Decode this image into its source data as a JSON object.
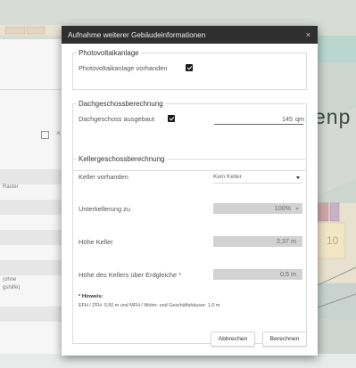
{
  "background": {
    "map_label": "enp",
    "map_number": "10",
    "side_texts": [
      "Raster",
      "(ohne",
      "gshilfe)"
    ]
  },
  "modal": {
    "title": "Aufnahme weiterer Gebäudeinformationen",
    "close_label": "×",
    "photovoltaik": {
      "legend": "Photovoltaikanlage",
      "label": "Photovoltaikanlage vorhanden",
      "checked": true
    },
    "dachgeschoss": {
      "legend": "Dachgeschossberechnung",
      "label": "Dachgeschoss ausgebaut",
      "checked": true,
      "value": "145",
      "unit": "qm"
    },
    "keller": {
      "legend": "Kellergeschossberechnung",
      "keller_vorhanden": {
        "label": "Keller vorhanden",
        "value": "Kein Keller"
      },
      "unterkellerung": {
        "label": "Unterkellerung zu",
        "value": "100%"
      },
      "hoehe_keller": {
        "label": "Höhe Keller",
        "value": "2,37",
        "unit": "m"
      },
      "hoehe_ueber_erdgleiche": {
        "label": "Höhe des Kellers über Erdgleiche *",
        "value": "0,5",
        "unit": "m"
      },
      "hint_title": "* Hinweis:",
      "hint_text": "EFH / ZFH: 0,50 m und MFH / Wohn- und Geschäftshäuser: 1,0 m"
    },
    "buttons": {
      "cancel": "Abbrechen",
      "calculate": "Berechnen"
    }
  },
  "colors": {
    "header_bg": "#2f2f2f",
    "checkbox": "#1a1a1a",
    "disabled_field": "#d2d2d2"
  }
}
